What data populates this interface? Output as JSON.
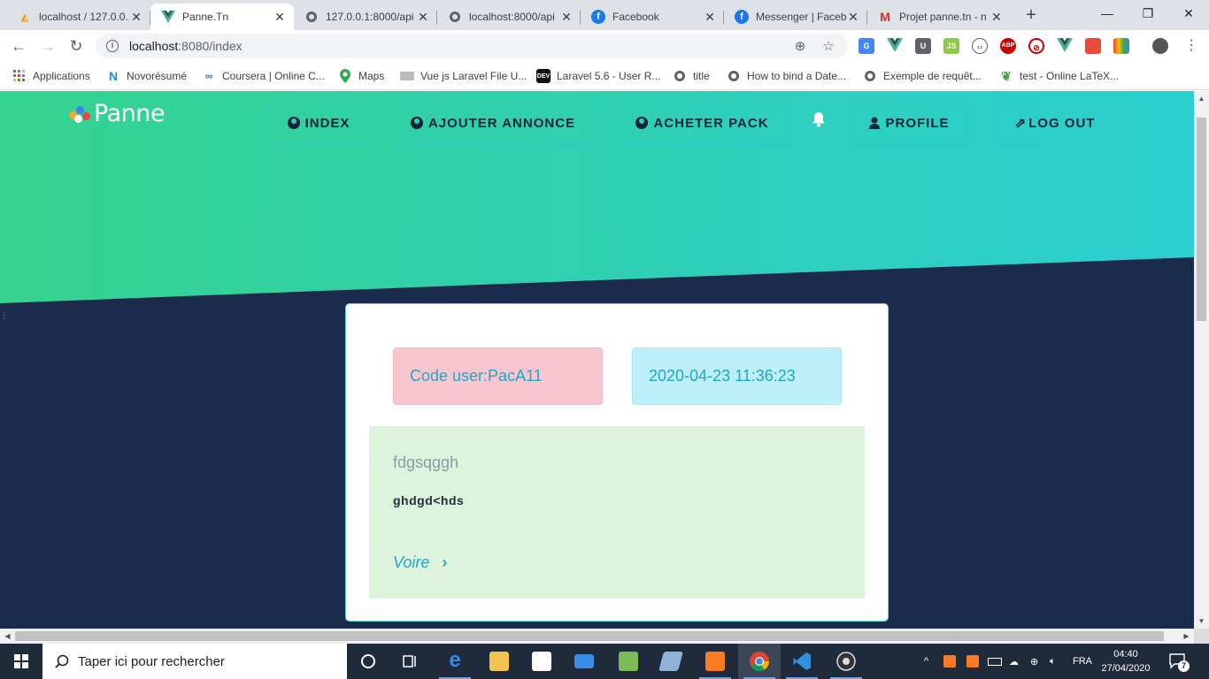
{
  "browser": {
    "tabs": [
      {
        "title": "localhost / 127.0.0.1",
        "icon": "phpmyadmin-icon"
      },
      {
        "title": "Panne.Tn",
        "icon": "vue-icon"
      },
      {
        "title": "127.0.0.1:8000/api",
        "icon": "globe-icon"
      },
      {
        "title": "localhost:8000/api",
        "icon": "globe-icon"
      },
      {
        "title": "Facebook",
        "icon": "facebook-icon"
      },
      {
        "title": "Messenger | Faceb",
        "icon": "facebook-icon"
      },
      {
        "title": "Projet panne.tn - n",
        "icon": "gmail-icon"
      }
    ],
    "url_host": "localhost",
    "url_path": ":8080/index",
    "bookmarks": [
      {
        "label": "Applications",
        "icon": "apps-grid-icon"
      },
      {
        "label": "Novorésumé",
        "icon": "novoresume-icon"
      },
      {
        "label": "Coursera | Online C...",
        "icon": "coursera-icon"
      },
      {
        "label": "Maps",
        "icon": "maps-icon"
      },
      {
        "label": "Vue js Laravel File U...",
        "icon": "page-icon"
      },
      {
        "label": "Laravel 5.6 - User R...",
        "icon": "dev-icon"
      },
      {
        "label": "title",
        "icon": "globe-icon"
      },
      {
        "label": "How to bind a Date...",
        "icon": "globe-icon"
      },
      {
        "label": "Exemple de requêt...",
        "icon": "globe-icon"
      },
      {
        "label": "test - Online LaTeX...",
        "icon": "overleaf-icon"
      }
    ]
  },
  "site": {
    "logo_text": "Panne",
    "nav": {
      "index": "INDEX",
      "add": "AJOUTER ANNONCE",
      "buy": "ACHETER PACK",
      "profile": "PROFILE",
      "logout": "LOG OUT"
    },
    "counter": "1",
    "annonce": {
      "code_user": "Code user:PacA11",
      "date": "2020-04-23 11:36:23",
      "title": "fdgsqggh",
      "description": "ghdgd<hds",
      "link_label": "Voire"
    },
    "colors": {
      "hero_start": "#34d38e",
      "hero_end": "#2bcfd0",
      "page_bg": "#1b2b4b",
      "accent": "#22a6c6"
    }
  },
  "taskbar": {
    "search_placeholder": "Taper ici pour rechercher",
    "language": "FRA",
    "time": "04:40",
    "date": "27/04/2020",
    "notification_count": "7"
  }
}
